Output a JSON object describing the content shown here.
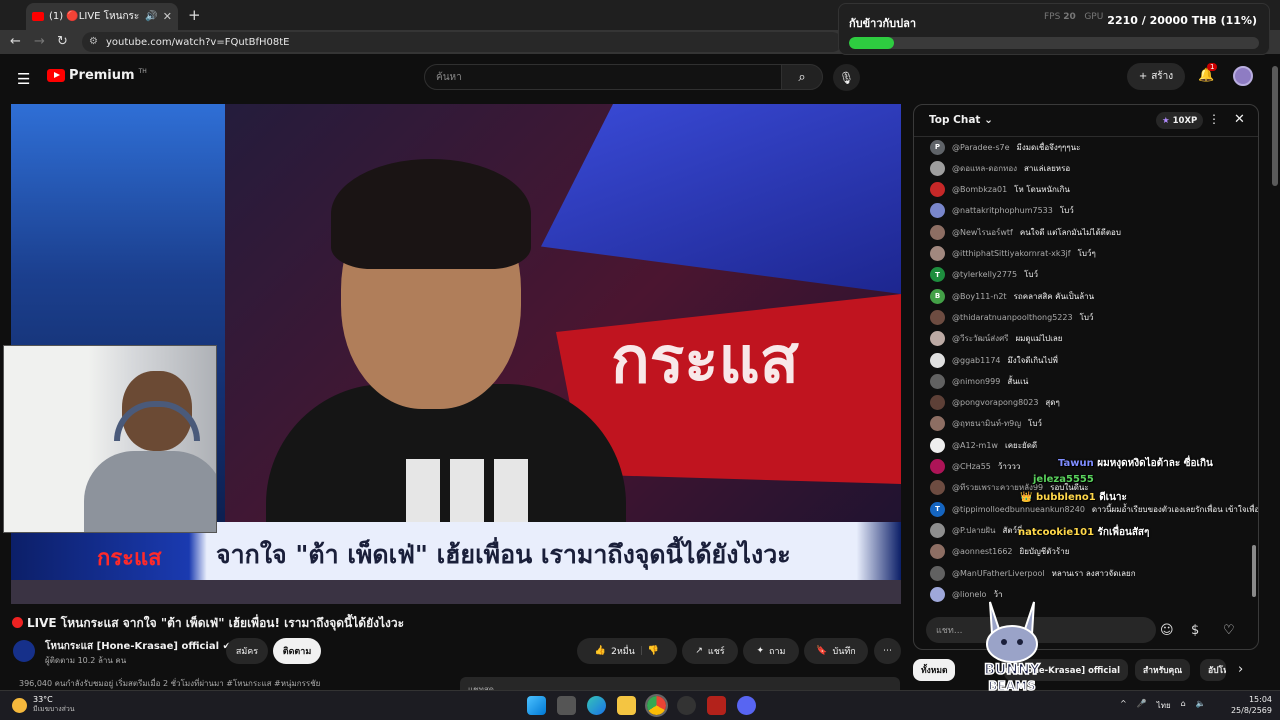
{
  "browser": {
    "tab_title": "(1) 🔴LIVE โหนกระแส จากใจ",
    "url": "youtube.com/watch?v=FQutBfH08tE"
  },
  "goal_widget": {
    "title": "กับข้าวกับปลา",
    "value": "2210 / 20000 THB (11%)",
    "progress": 0.11,
    "fps_label": "FPS",
    "fps": "20",
    "extra": "GPU"
  },
  "header": {
    "brand": "Premium",
    "brand_sup": "TH",
    "search_placeholder": "ค้นหา",
    "create_label": "สร้าง",
    "notif_count": "1"
  },
  "video": {
    "caption": "จากใจ \"ต้า เพ็ดเฟ่\" เฮ้ยเพื่อน เรามาถึงจุดนี้ได้ยังไงวะ",
    "caption_brand": "กระแส",
    "title": "LIVE โหนกระแส จากใจ \"ต้า เพ็ดเฟ่\" เฮ้ยเพื่อน! เรามาถึงจุดนี้ได้ยังไงวะ",
    "channel": "โหนกระแส [Hone-Krasae] official",
    "subs": "ผู้ติดตาม 10.2 ล้าน คน",
    "buttons": {
      "join": "สมัคร",
      "subscribe": "ติดตาม",
      "likes": "2หมื่น",
      "share": "แชร์",
      "ask": "ถาม",
      "save": "บันทึก"
    },
    "description": "396,040 คนกำลังรับชมอยู่ เริ่มสตรีมเมื่อ 2 ชั่วโมงที่ผ่านมา  #โหนกระแส #หนุ่มกรรชัย",
    "desc_label": "แชทสด"
  },
  "chat": {
    "mode": "Top Chat",
    "xp": "10XP",
    "input_placeholder": "แชท...",
    "messages": [
      {
        "author": "@Paradee-s7e",
        "text": "มีงมดเชื่อจึงๆๆๆนะ",
        "avatar": "P",
        "color": "#5f6368"
      },
      {
        "author": "@ดอแหล-ดอกทอง",
        "text": "สาแล่เลยหรอ",
        "avatar": "",
        "color": "#9e9e9e"
      },
      {
        "author": "@Bombkza01",
        "text": "โห โดนหนักเกิน",
        "avatar": "",
        "color": "#c62828"
      },
      {
        "author": "@nattakritphophum7533",
        "text": "โบว์",
        "avatar": "",
        "color": "#7986cb"
      },
      {
        "author": "@Newไรนอร์wtf",
        "text": "คนใจดี แต่โลกมันไม่ได้ดีตอบ",
        "avatar": "",
        "color": "#8d6e63"
      },
      {
        "author": "@itthiphatSittiyakornrat-xk3jf",
        "text": "โบว์ๆ",
        "avatar": "",
        "color": "#a1887f"
      },
      {
        "author": "@tylerkelly2775",
        "text": "โบว์",
        "avatar": "T",
        "color": "#1e8e3e"
      },
      {
        "author": "@Boy111-n2t",
        "text": "รถคลาสสิค คันเป็นล้าน",
        "avatar": "B",
        "color": "#43a047"
      },
      {
        "author": "@thidaratnuanpoolthong5223",
        "text": "โบว์",
        "avatar": "",
        "color": "#6d4c41"
      },
      {
        "author": "@วีระวัฒน์ส่งศรี",
        "text": "ผมดูแม่ไปเลย",
        "avatar": "",
        "color": "#bcaaa4"
      },
      {
        "author": "@ggab1174",
        "text": "มึงใจดีเกินไปพี่",
        "avatar": "",
        "color": "#e0e0e0"
      },
      {
        "author": "@nimon999",
        "text": "สั้นแน่",
        "avatar": "",
        "color": "#616161"
      },
      {
        "author": "@pongvorapong8023",
        "text": "สุดๆ",
        "avatar": "",
        "color": "#5d4037"
      },
      {
        "author": "@ฤทธนามินท์-ท9ญ",
        "text": "โบว์",
        "avatar": "",
        "color": "#8d6e63"
      },
      {
        "author": "@A12-m1w",
        "text": "เคยะยัดดี",
        "avatar": "",
        "color": "#eeeeee"
      },
      {
        "author": "@CHza55",
        "text": "ว้าววว",
        "avatar": "",
        "color": "#ad1457"
      },
      {
        "author": "@ทีรวยเพราะควายหลัง99",
        "text": "รอบในดีนะ",
        "avatar": "",
        "color": "#6d4c41"
      },
      {
        "author": "@tippimolloedbunnueankun8240",
        "text": "ดาวนี้ผมอ้ำเรียบของตัวเองเลยรักเพื่อน เข้าใจเพื่อนหมดเลย",
        "avatar": "T",
        "color": "#1565c0"
      },
      {
        "author": "@P.ปลายฝัน",
        "text": "สัตว์นี่",
        "avatar": "",
        "color": "#8e8e8e"
      },
      {
        "author": "@aonnest1662",
        "text": "ยิยบัญชีตัวร้าย",
        "avatar": "",
        "color": "#8d6e63"
      },
      {
        "author": "@ManUFatherLiverpool",
        "text": "หลานเรา ลงสาวจัดเลยก",
        "avatar": "",
        "color": "#616161"
      },
      {
        "author": "@lionelo",
        "text": "ว้า",
        "avatar": "",
        "color": "#9fa8da"
      }
    ],
    "overlay": [
      {
        "name": "Tawun",
        "text": "ผมหงุดหงิดไอต้าละ ซื่อเกิน",
        "color": "#7f8dff"
      },
      {
        "name": "jeleza5555",
        "text": "",
        "color": "#59d15c"
      },
      {
        "name": "bubbleno1",
        "text": "ดีเนาะ",
        "color": "#ffd84a"
      },
      {
        "name": "natcookie101",
        "text": "รักเพื่อนสัสๆ",
        "color": "#ffd84a"
      }
    ]
  },
  "filters": [
    "ทั้งหมด",
    "จาก โหนกระแส [Hone-Krasae] official",
    "สำหรับคุณ",
    "อัปโหลด"
  ],
  "overlay_logo": "BUNNY BEAMS",
  "taskbar": {
    "temp": "33°C",
    "weather": "มีเมฆบางส่วน",
    "lang": "ไทย",
    "time": "15:04",
    "date": "25/8/2569"
  }
}
